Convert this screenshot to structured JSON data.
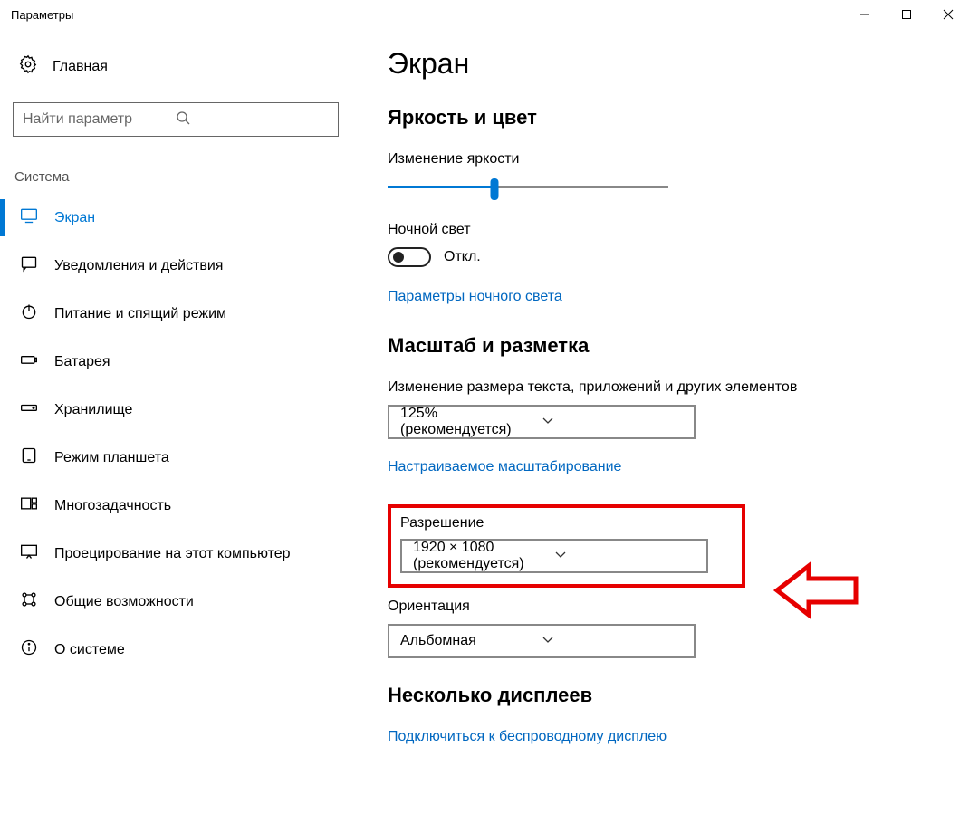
{
  "window": {
    "title": "Параметры"
  },
  "sidebar": {
    "home": "Главная",
    "search_placeholder": "Найти параметр",
    "section": "Система",
    "items": [
      {
        "label": "Экран"
      },
      {
        "label": "Уведомления и действия"
      },
      {
        "label": "Питание и спящий режим"
      },
      {
        "label": "Батарея"
      },
      {
        "label": "Хранилище"
      },
      {
        "label": "Режим планшета"
      },
      {
        "label": "Многозадачность"
      },
      {
        "label": "Проецирование на этот компьютер"
      },
      {
        "label": "Общие возможности"
      },
      {
        "label": "О системе"
      }
    ]
  },
  "main": {
    "title": "Экран",
    "brightness": {
      "heading": "Яркость и цвет",
      "slider_label": "Изменение яркости",
      "slider_value_pct": 38,
      "nightlight_label": "Ночной свет",
      "nightlight_state": "Откл.",
      "nightlight_link": "Параметры ночного света"
    },
    "scale": {
      "heading": "Масштаб и разметка",
      "size_label": "Изменение размера текста, приложений и других элементов",
      "size_value": "125% (рекомендуется)",
      "custom_link": "Настраиваемое масштабирование",
      "resolution_label": "Разрешение",
      "resolution_value": "1920 × 1080 (рекомендуется)",
      "orientation_label": "Ориентация",
      "orientation_value": "Альбомная"
    },
    "multi": {
      "heading": "Несколько дисплеев",
      "wireless_link": "Подключиться к беспроводному дисплею"
    }
  }
}
